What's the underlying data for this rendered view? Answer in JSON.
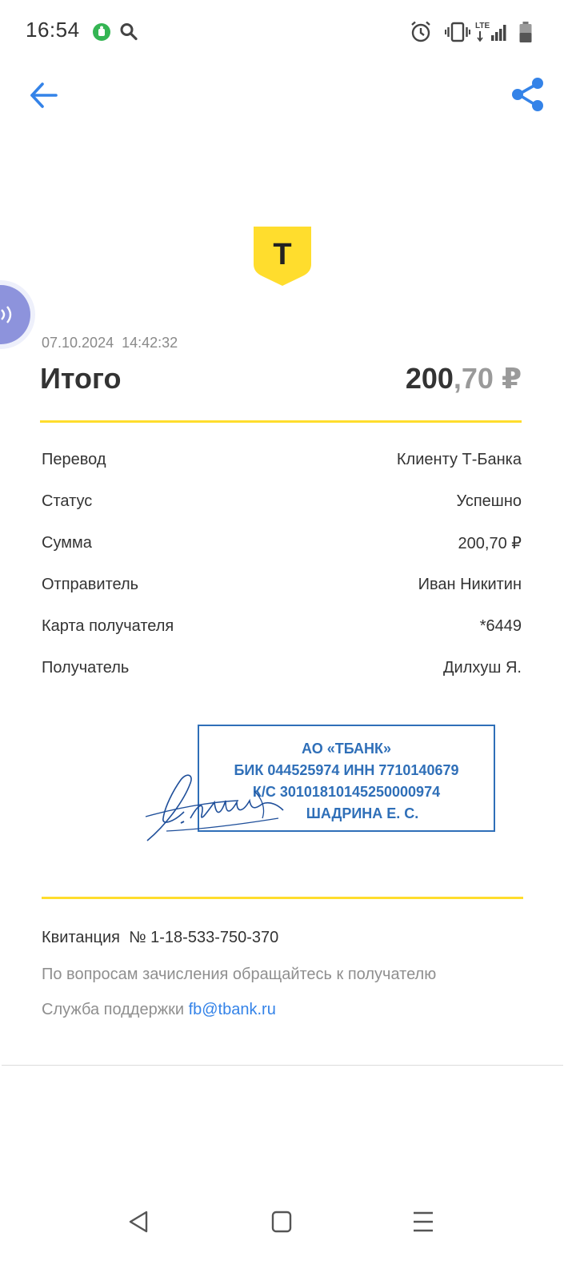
{
  "status_bar": {
    "time": "16:54",
    "network_label": "LTE",
    "icons": [
      "app-notification-icon",
      "search-icon",
      "alarm-icon",
      "vibrate-icon",
      "lte-signal-icon",
      "battery-icon"
    ]
  },
  "app_bar": {
    "back_icon": "arrow-left-icon",
    "share_icon": "share-icon"
  },
  "brand": {
    "logo_letter": "Т",
    "logo_color": "#ffdd2d"
  },
  "receipt": {
    "datetime": "07.10.2024  14:42:32",
    "total_label": "Итого",
    "total_int": "200",
    "total_frac": ",70 ₽",
    "rows": [
      {
        "label": "Перевод",
        "value": "Клиенту Т-Банка"
      },
      {
        "label": "Статус",
        "value": "Успешно"
      },
      {
        "label": "Сумма",
        "value": "200,70 ₽"
      },
      {
        "label": "Отправитель",
        "value": "Иван Никитин"
      },
      {
        "label": "Карта получателя",
        "value": "*6449"
      },
      {
        "label": "Получатель",
        "value": "Дилхуш Я."
      }
    ],
    "stamp": {
      "line1": "АО «ТБАНК»",
      "line2": "БИК 044525974 ИНН 7710140679",
      "line3": "К/С 30101810145250000974",
      "line4": "ШАДРИНА Е. С."
    },
    "receipt_number": "Квитанция  № 1-18-533-750-370",
    "info_text": "По вопросам зачисления обращайтесь к получателю",
    "support_label": "Служба поддержки ",
    "support_email": "fb@tbank.ru"
  },
  "colors": {
    "accent_blue": "#3483e8",
    "brand_yellow": "#ffdd2d",
    "stamp_blue": "#2f6fb8",
    "assistant_bubble": "#8d93dc"
  },
  "nav_bar": {
    "icons": [
      "back-triangle-icon",
      "home-square-icon",
      "menu-lines-icon"
    ]
  }
}
